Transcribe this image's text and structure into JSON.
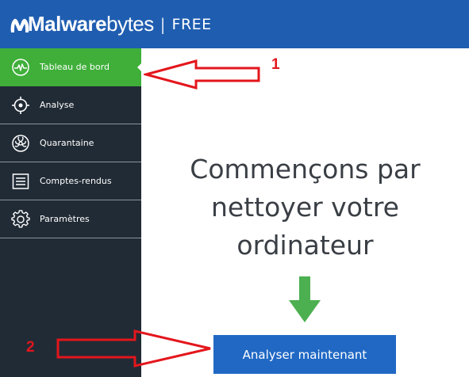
{
  "app": {
    "brand_bold": "Malware",
    "brand_light": "bytes",
    "separator": "|",
    "edition": "FREE",
    "colors": {
      "titlebar": "#1f5db0",
      "sidebar": "#212b35",
      "active_item": "#3faf3a",
      "primary_button": "#2068c4",
      "green_arrow": "#4caf50",
      "annotation_red": "#e3161c"
    }
  },
  "sidebar": {
    "items": [
      {
        "label": "Tableau de bord",
        "icon": "pulse-icon",
        "active": true
      },
      {
        "label": "Analyse",
        "icon": "crosshair-icon",
        "active": false
      },
      {
        "label": "Quarantaine",
        "icon": "biohazard-icon",
        "active": false
      },
      {
        "label": "Comptes-rendus",
        "icon": "report-list-icon",
        "active": false
      },
      {
        "label": "Paramètres",
        "icon": "gear-icon",
        "active": false
      }
    ]
  },
  "main": {
    "headline_lines": [
      "Commençons par",
      "nettoyer votre",
      "ordinateur"
    ],
    "scan_button_label": "Analyser maintenant"
  },
  "annotations": {
    "callout_1": "1",
    "callout_2": "2"
  }
}
